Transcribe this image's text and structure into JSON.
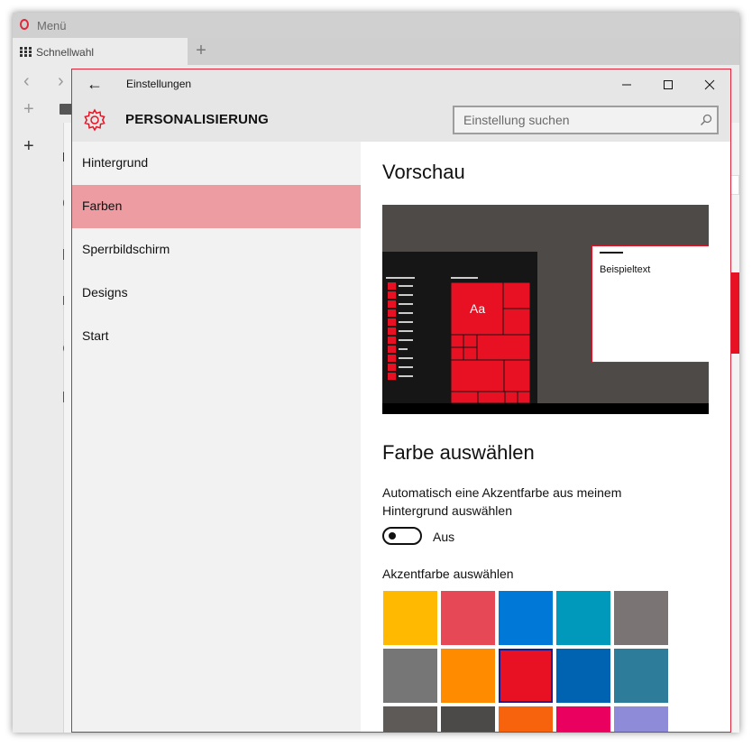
{
  "browser": {
    "menu_label": "Menü",
    "tab_label": "Schnellwahl",
    "new_tab_icon": "+"
  },
  "settings": {
    "window_title": "Einstellungen",
    "section_title": "PERSONALISIERUNG",
    "search_placeholder": "Einstellung suchen",
    "nav_items": [
      {
        "label": "Hintergrund",
        "selected": false
      },
      {
        "label": "Farben",
        "selected": true
      },
      {
        "label": "Sperrbildschirm",
        "selected": false
      },
      {
        "label": "Designs",
        "selected": false
      },
      {
        "label": "Start",
        "selected": false
      }
    ],
    "preview_heading": "Vorschau",
    "preview_sample_text": "Beispieltext",
    "preview_tile_label": "Aa",
    "color_heading": "Farbe auswählen",
    "auto_accent_line1": "Automatisch eine Akzentfarbe aus meinem",
    "auto_accent_line2": "Hintergrund auswählen",
    "toggle_state": "Aus",
    "accent_label": "Akzentfarbe auswählen",
    "accent_color": "#e81123",
    "swatches": [
      "#ffb900",
      "#e74856",
      "#0078d7",
      "#0099bc",
      "#7a7574",
      "#767676",
      "#ff8c00",
      "#e81123",
      "#0063b1",
      "#2d7d9a",
      "#5d5a58",
      "#4c4a48",
      "#f7630c",
      "#ea005e",
      "#8e8cd8"
    ],
    "selected_swatch": 7
  }
}
